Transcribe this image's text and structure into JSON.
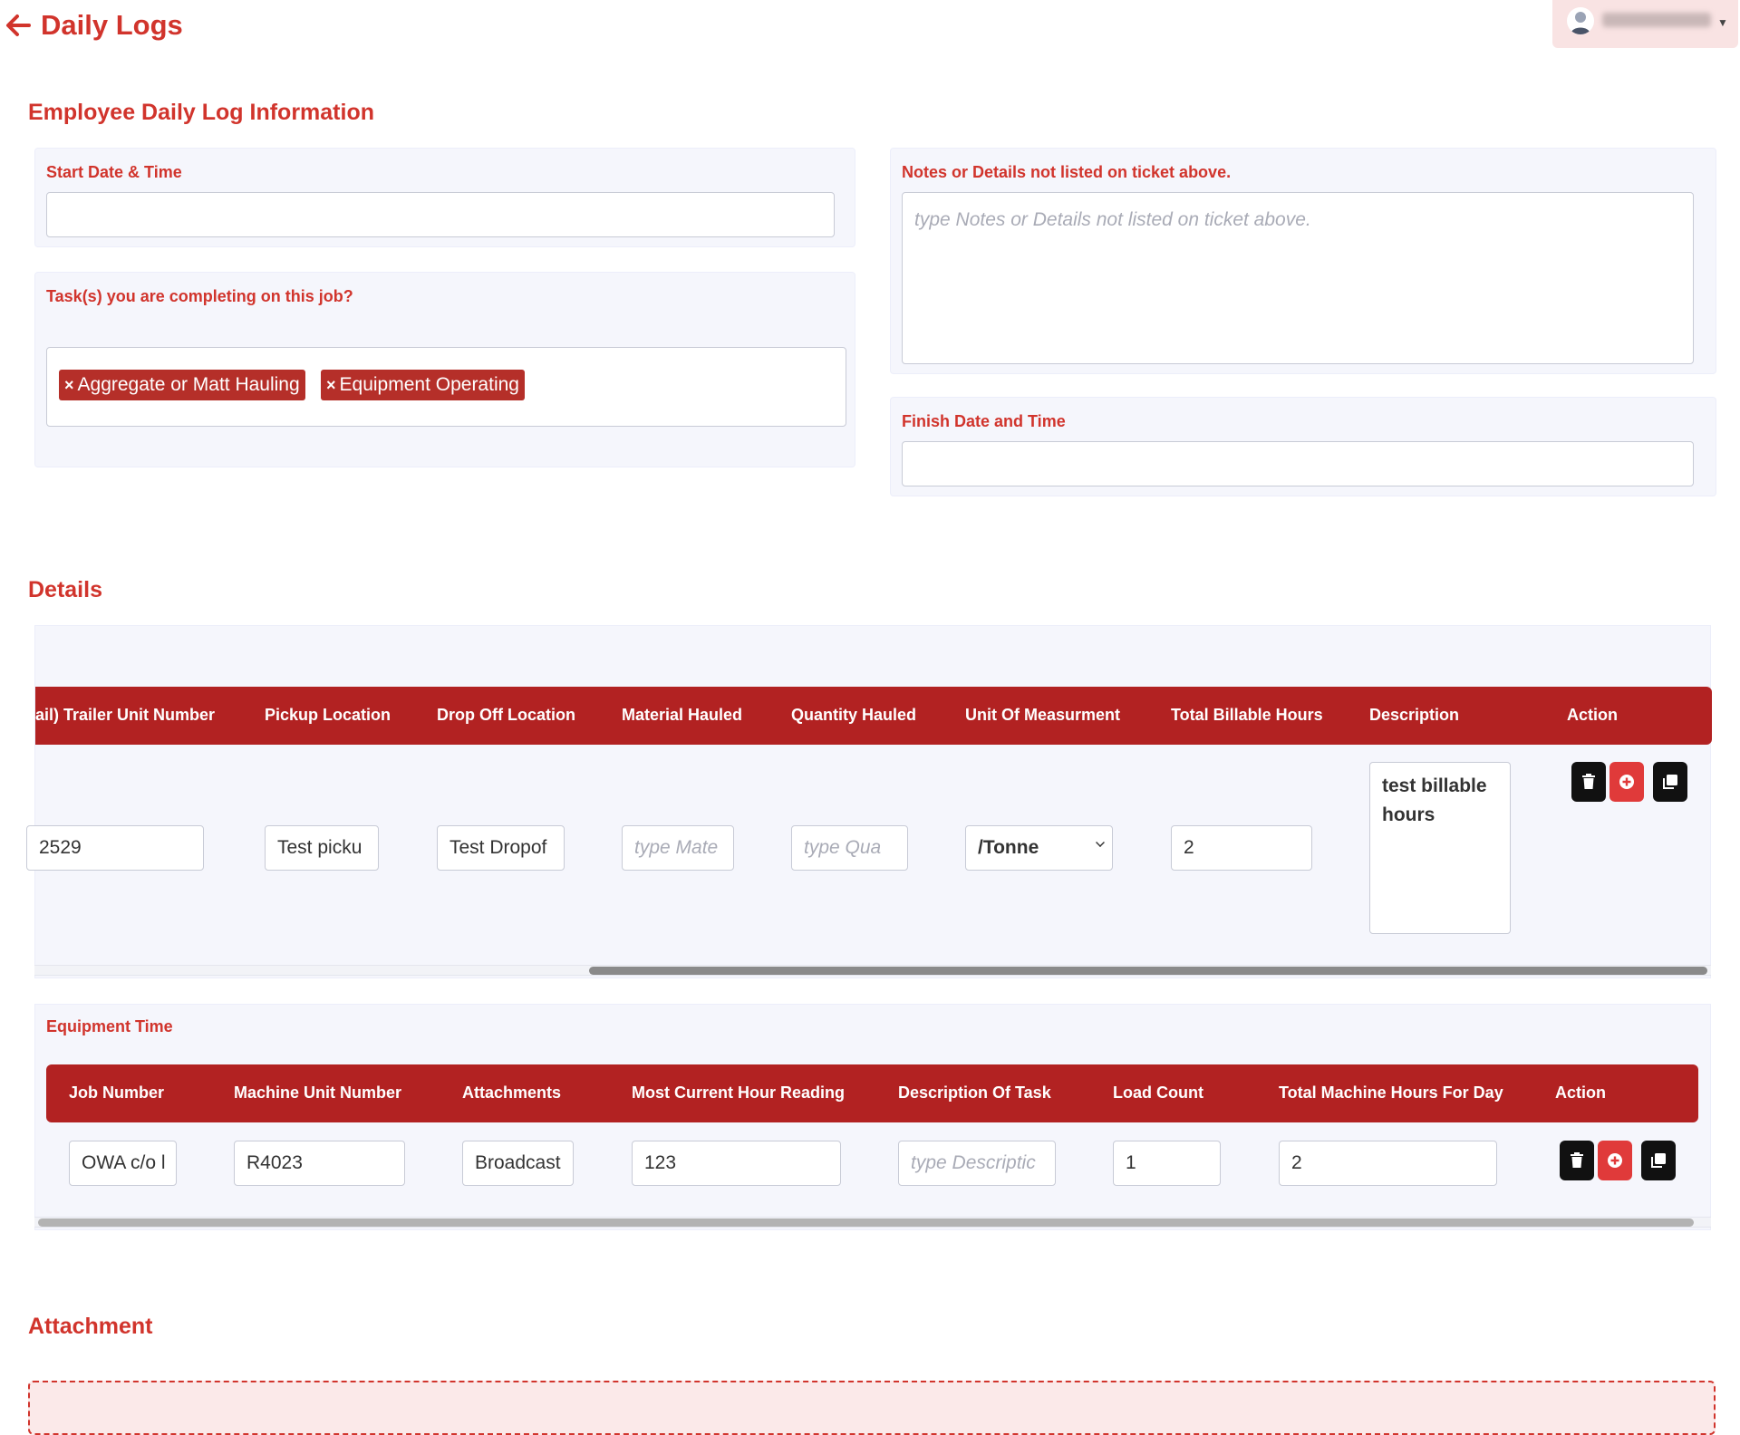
{
  "header": {
    "title": "Daily Logs"
  },
  "info_section": {
    "title": "Employee Daily Log Information",
    "start_label": "Start Date & Time",
    "start_value": "",
    "tasks_label": "Task(s) you are completing on this job?",
    "tasks": [
      "Aggregate or Matt Hauling",
      "Equipment Operating"
    ],
    "tag_remove": "×",
    "notes_label": "Notes or Details not listed on ticket above.",
    "notes_placeholder": "type Notes or Details not listed on ticket above.",
    "finish_label": "Finish Date and Time",
    "finish_value": ""
  },
  "details": {
    "title": "Details",
    "headers": [
      "ail) Trailer Unit Number",
      "Pickup Location",
      "Drop Off Location",
      "Material Hauled",
      "Quantity Hauled",
      "Unit Of Measurment",
      "Total Billable Hours",
      "Description",
      "Action"
    ],
    "row": {
      "trailer": "2529",
      "pickup": "Test picku",
      "dropoff": "Test Dropof",
      "material_placeholder": "type Mate",
      "quantity_placeholder": "type Qua",
      "unit": "/Tonne",
      "billable_hours": "2",
      "description": "test billable hours"
    }
  },
  "equipment": {
    "label": "Equipment Time",
    "headers": [
      "Job Number",
      "Machine Unit Number",
      "Attachments",
      "Most Current Hour Reading",
      "Description Of Task",
      "Load Count",
      "Total Machine Hours For Day",
      "Action"
    ],
    "row": {
      "job": "OWA c/o l",
      "machine": "R4023",
      "attachments": "Broadcast",
      "hour_reading": "123",
      "task_placeholder": "type Descriptic",
      "load_count": "1",
      "machine_hours": "2"
    }
  },
  "attachment": {
    "title": "Attachment"
  },
  "colors": {
    "accent": "#d1342c",
    "header_bar": "#b22222",
    "card_bg": "#f5f6fc"
  },
  "icons": [
    "back-arrow-icon",
    "user-avatar-icon",
    "chevron-down-icon",
    "trash-icon",
    "plus-circle-icon",
    "copy-icon"
  ]
}
